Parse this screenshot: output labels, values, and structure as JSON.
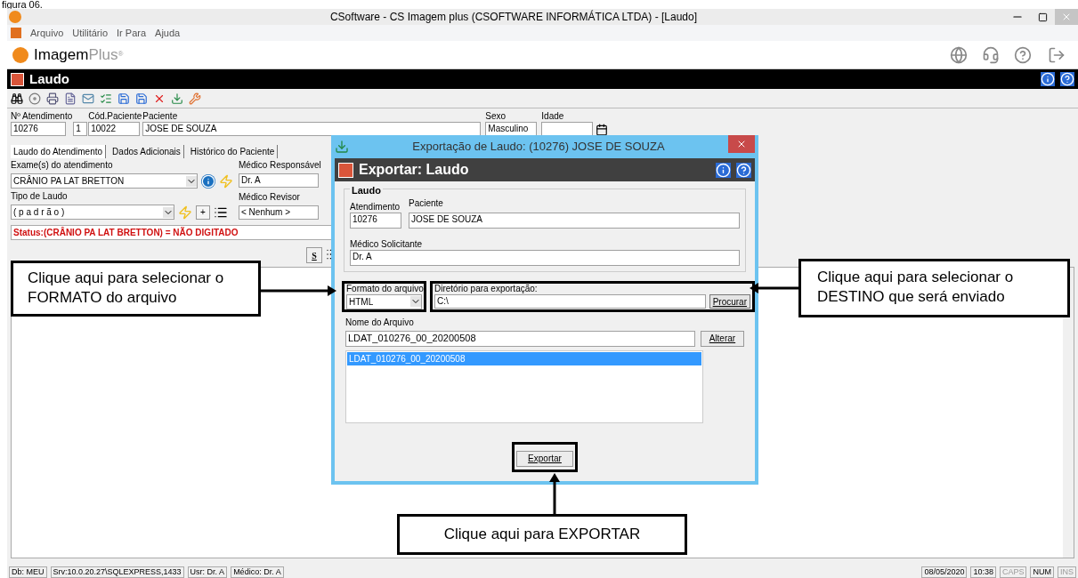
{
  "caption": "figura 06.",
  "window": {
    "title": "CSoftware - CS Imagem plus (CSOFTWARE INFORMÁTICA LTDA) - [Laudo]"
  },
  "menu": [
    "Arquivo",
    "Utilitário",
    "Ir Para",
    "Ajuda"
  ],
  "logo": {
    "text": "Imagem",
    "accent": "Plus",
    "mark": "®"
  },
  "form_title": "Laudo",
  "patient_fields": [
    {
      "label": "Nº Atendimento",
      "value": "10276"
    },
    {
      "value": "1"
    },
    {
      "label": "Cód.Paciente",
      "value": "10022"
    },
    {
      "label": "Paciente",
      "value": "JOSE DE SOUZA"
    }
  ],
  "sex": {
    "label": "Sexo",
    "value": "Masculino"
  },
  "age": {
    "label": "Idade"
  },
  "tabs": [
    {
      "label": "Laudo do Atendimento",
      "selected": true
    },
    {
      "label": "Dados Adicionais",
      "selected": false
    },
    {
      "label": "Histórico do Paciente",
      "selected": false
    }
  ],
  "exam": {
    "label": "Exame(s) do atendimento",
    "value": "CRÂNIO PA LAT BRETTON"
  },
  "doctor": {
    "label": "Médico Responsável",
    "value": "Dr. A"
  },
  "report_type": {
    "label": "Tipo de Laudo",
    "value": "( p a d r ã o )",
    "add": "+"
  },
  "reviewer": {
    "label": "Médico Revisor",
    "value": "< Nenhum >"
  },
  "status_text": "Status:(CRÂNIO PA LAT BRETTON) = NÃO DIGITADO",
  "strike_button": "S",
  "dialog": {
    "title": "Exportação de Laudo: (10276) JOSE DE SOUZA",
    "header": "Exportar: Laudo",
    "group": "Laudo",
    "atendimento": {
      "label": "Atendimento",
      "value": "10276"
    },
    "paciente": {
      "label": "Paciente",
      "value": "JOSE DE SOUZA"
    },
    "medico": {
      "label": "Médico Solicitante",
      "value": "Dr. A"
    },
    "format": {
      "label": "Formato do arquivo",
      "value": "HTML"
    },
    "directory": {
      "label": "Diretório para exportação:",
      "value": "C:\\",
      "button": "Procurar"
    },
    "filename": {
      "label": "Nome do Arquivo",
      "value": "LDAT_010276_00_20200508",
      "button": "Alterar"
    },
    "files": [
      {
        "name": "LDAT_010276_00_20200508",
        "selected": true
      }
    ],
    "export_button": "Exportar"
  },
  "callouts": [
    "Clique aqui para selecionar o FORMATO do arquivo",
    "Clique aqui para selecionar o DESTINO que será enviado",
    "Clique aqui para EXPORTAR"
  ],
  "status_bar": [
    {
      "text": "Db: MEU",
      "disabled": false
    },
    {
      "text": "Srv:10.0.20.27\\SQLEXPRESS,1433",
      "disabled": false
    },
    {
      "text": "Usr: Dr. A",
      "disabled": false
    },
    {
      "text": "Médico: Dr. A",
      "disabled": false
    }
  ],
  "status_right": [
    {
      "text": "08/05/2020",
      "disabled": false
    },
    {
      "text": "10:38",
      "disabled": false
    },
    {
      "text": "CAPS",
      "disabled": true
    },
    {
      "text": "NUM",
      "disabled": false
    },
    {
      "text": "INS",
      "disabled": true
    }
  ]
}
